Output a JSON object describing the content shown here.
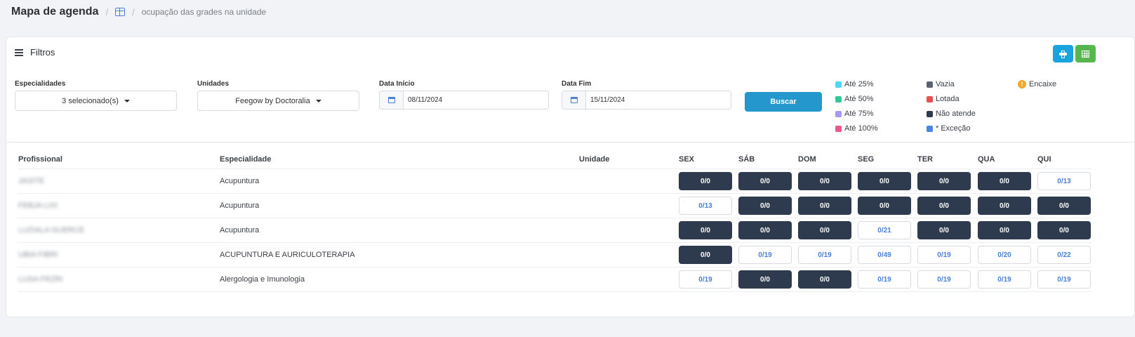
{
  "header": {
    "title": "Mapa de agenda",
    "breadcrumb_icon": "grid-icon",
    "breadcrumb": "ocupação das grades na unidade"
  },
  "filters": {
    "title": "Filtros",
    "especialidades_label": "Especialidades",
    "especialidades_value": "3 selecionado(s)",
    "unidades_label": "Unidades",
    "unidades_value": "Feegow by Doctoralia",
    "data_inicio_label": "Data Início",
    "data_inicio_value": "08/11/2024",
    "data_fim_label": "Data Fim",
    "data_fim_value": "15/11/2024",
    "search_label": "Buscar",
    "print_icon": "printer-icon",
    "excel_icon": "table-icon"
  },
  "colors": {
    "dark_slot": "#2e3b4e",
    "link_blue": "#4a7fd4",
    "buscar": "#2497cc",
    "print": "#1aa3dd",
    "excel": "#55b74e"
  },
  "legend": [
    {
      "label": "Até 25%",
      "color": "#4dd6f0"
    },
    {
      "label": "Até 50%",
      "color": "#2dc99b"
    },
    {
      "label": "Até 75%",
      "color": "#a59af0"
    },
    {
      "label": "Até 100%",
      "color": "#f0558f"
    },
    {
      "label": "Vazia",
      "color": "#5b6370"
    },
    {
      "label": "Lotada",
      "color": "#ea4f4f"
    },
    {
      "label": "Não atende",
      "color": "#2e3b4e"
    },
    {
      "label": "* Exceção",
      "color": "#4a87e4"
    },
    {
      "label": "Encaixe",
      "icon": "warning-icon",
      "color": "#f0a92a"
    }
  ],
  "table": {
    "headers": {
      "profissional": "Profissional",
      "especialidade": "Especialidade",
      "unidade": "Unidade",
      "days": [
        "SEX",
        "SÁB",
        "DOM",
        "SEG",
        "TER",
        "QUA",
        "QUI"
      ]
    },
    "rows": [
      {
        "profissional": "JASITE",
        "especialidade": "Acupuntura",
        "unidade": "",
        "slots": [
          {
            "v": "0/0",
            "dark": true
          },
          {
            "v": "0/0",
            "dark": true
          },
          {
            "v": "0/0",
            "dark": true
          },
          {
            "v": "0/0",
            "dark": true
          },
          {
            "v": "0/0",
            "dark": true
          },
          {
            "v": "0/0",
            "dark": true
          },
          {
            "v": "0/13",
            "dark": false
          }
        ]
      },
      {
        "profissional": "FEBJA LIXI",
        "especialidade": "Acupuntura",
        "unidade": "",
        "slots": [
          {
            "v": "0/13",
            "dark": false
          },
          {
            "v": "0/0",
            "dark": true
          },
          {
            "v": "0/0",
            "dark": true
          },
          {
            "v": "0/0",
            "dark": true
          },
          {
            "v": "0/0",
            "dark": true
          },
          {
            "v": "0/0",
            "dark": true
          },
          {
            "v": "0/0",
            "dark": true
          }
        ]
      },
      {
        "profissional": "LUZIALA GUERCE",
        "especialidade": "Acupuntura",
        "unidade": "",
        "slots": [
          {
            "v": "0/0",
            "dark": true
          },
          {
            "v": "0/0",
            "dark": true
          },
          {
            "v": "0/0",
            "dark": true
          },
          {
            "v": "0/21",
            "dark": false
          },
          {
            "v": "0/0",
            "dark": true
          },
          {
            "v": "0/0",
            "dark": true
          },
          {
            "v": "0/0",
            "dark": true
          }
        ]
      },
      {
        "profissional": "UBIA FIBRI",
        "especialidade": "ACUPUNTURA E AURICULOTERAPIA",
        "unidade": "",
        "slots": [
          {
            "v": "0/0",
            "dark": true
          },
          {
            "v": "0/19",
            "dark": false
          },
          {
            "v": "0/19",
            "dark": false
          },
          {
            "v": "0/49",
            "dark": false
          },
          {
            "v": "0/19",
            "dark": false
          },
          {
            "v": "0/20",
            "dark": false
          },
          {
            "v": "0/22",
            "dark": false
          }
        ]
      },
      {
        "profissional": "LUSA FRZRI",
        "especialidade": "Alergologia e Imunologia",
        "unidade": "",
        "slots": [
          {
            "v": "0/19",
            "dark": false
          },
          {
            "v": "0/0",
            "dark": true
          },
          {
            "v": "0/0",
            "dark": true
          },
          {
            "v": "0/19",
            "dark": false
          },
          {
            "v": "0/19",
            "dark": false
          },
          {
            "v": "0/19",
            "dark": false
          },
          {
            "v": "0/19",
            "dark": false
          }
        ]
      }
    ]
  }
}
